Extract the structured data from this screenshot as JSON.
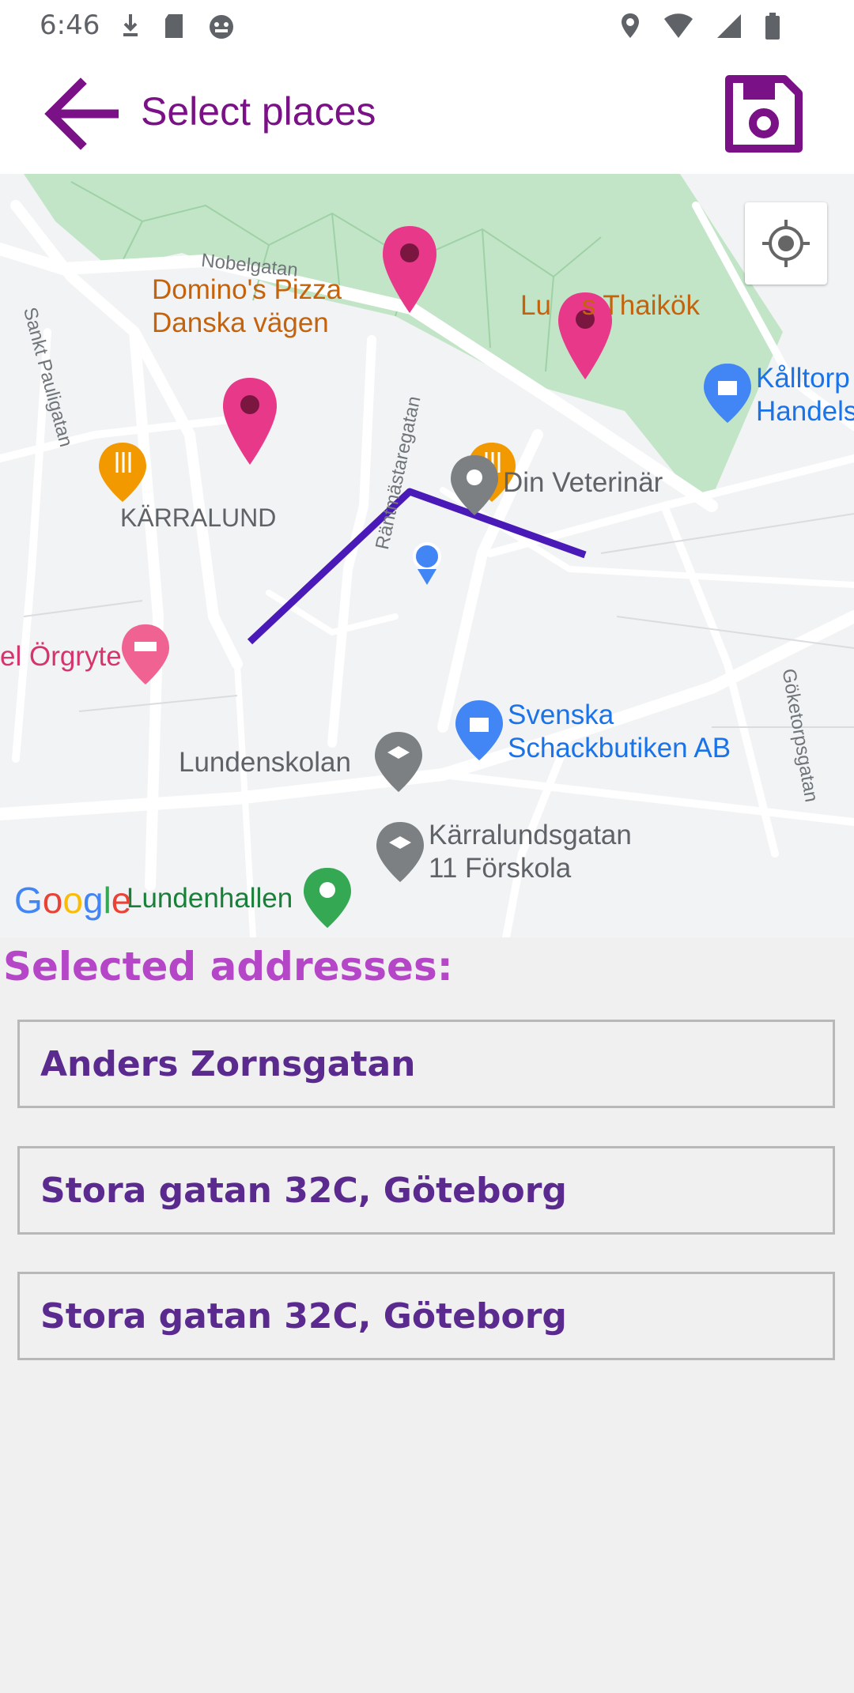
{
  "status_bar": {
    "time": "6:46",
    "left_icons": [
      "download-icon",
      "sd-card-icon",
      "android-debug-icon"
    ],
    "right_icons": [
      "location-icon",
      "wifi-icon",
      "cell-signal-icon",
      "battery-icon"
    ]
  },
  "app_bar": {
    "title": "Select places",
    "back_icon": "arrow-back-icon",
    "save_icon": "floppy-save-icon",
    "accent_color": "#7b1187"
  },
  "map": {
    "pois": {
      "dominos": "Domino's Pizza\nDanska vägen",
      "thai": "Lu    s Thaikök",
      "kalltorp": "Kålltorp\nHandels",
      "veterinar": "Din Veterinär",
      "karralund": "KÄRRALUND",
      "orgryte": "el Örgryte",
      "schack": "Svenska\nSchackbutiken AB",
      "lundenskolan": "Lundenskolan",
      "forskola": "Kärralundsgatan\n11 Förskola",
      "lundenhallen": "Lundenhallen"
    },
    "streets": {
      "nobelgatan": "Nobelgatan",
      "sankt": "Sankt Pauligatan",
      "rantmastaregatan": "Räntmästaregatan",
      "goketorpsgatan": "Göketorpsgatan"
    },
    "markers": 3,
    "route_color": "#4a1ab8",
    "marker_color": "#e8388a",
    "locate_icon": "my-location-icon",
    "logo": "Google"
  },
  "selected": {
    "title": "Selected addresses:",
    "addresses": [
      "Anders Zornsgatan",
      "Stora gatan 32C, Göteborg",
      "Stora gatan 32C, Göteborg"
    ]
  }
}
